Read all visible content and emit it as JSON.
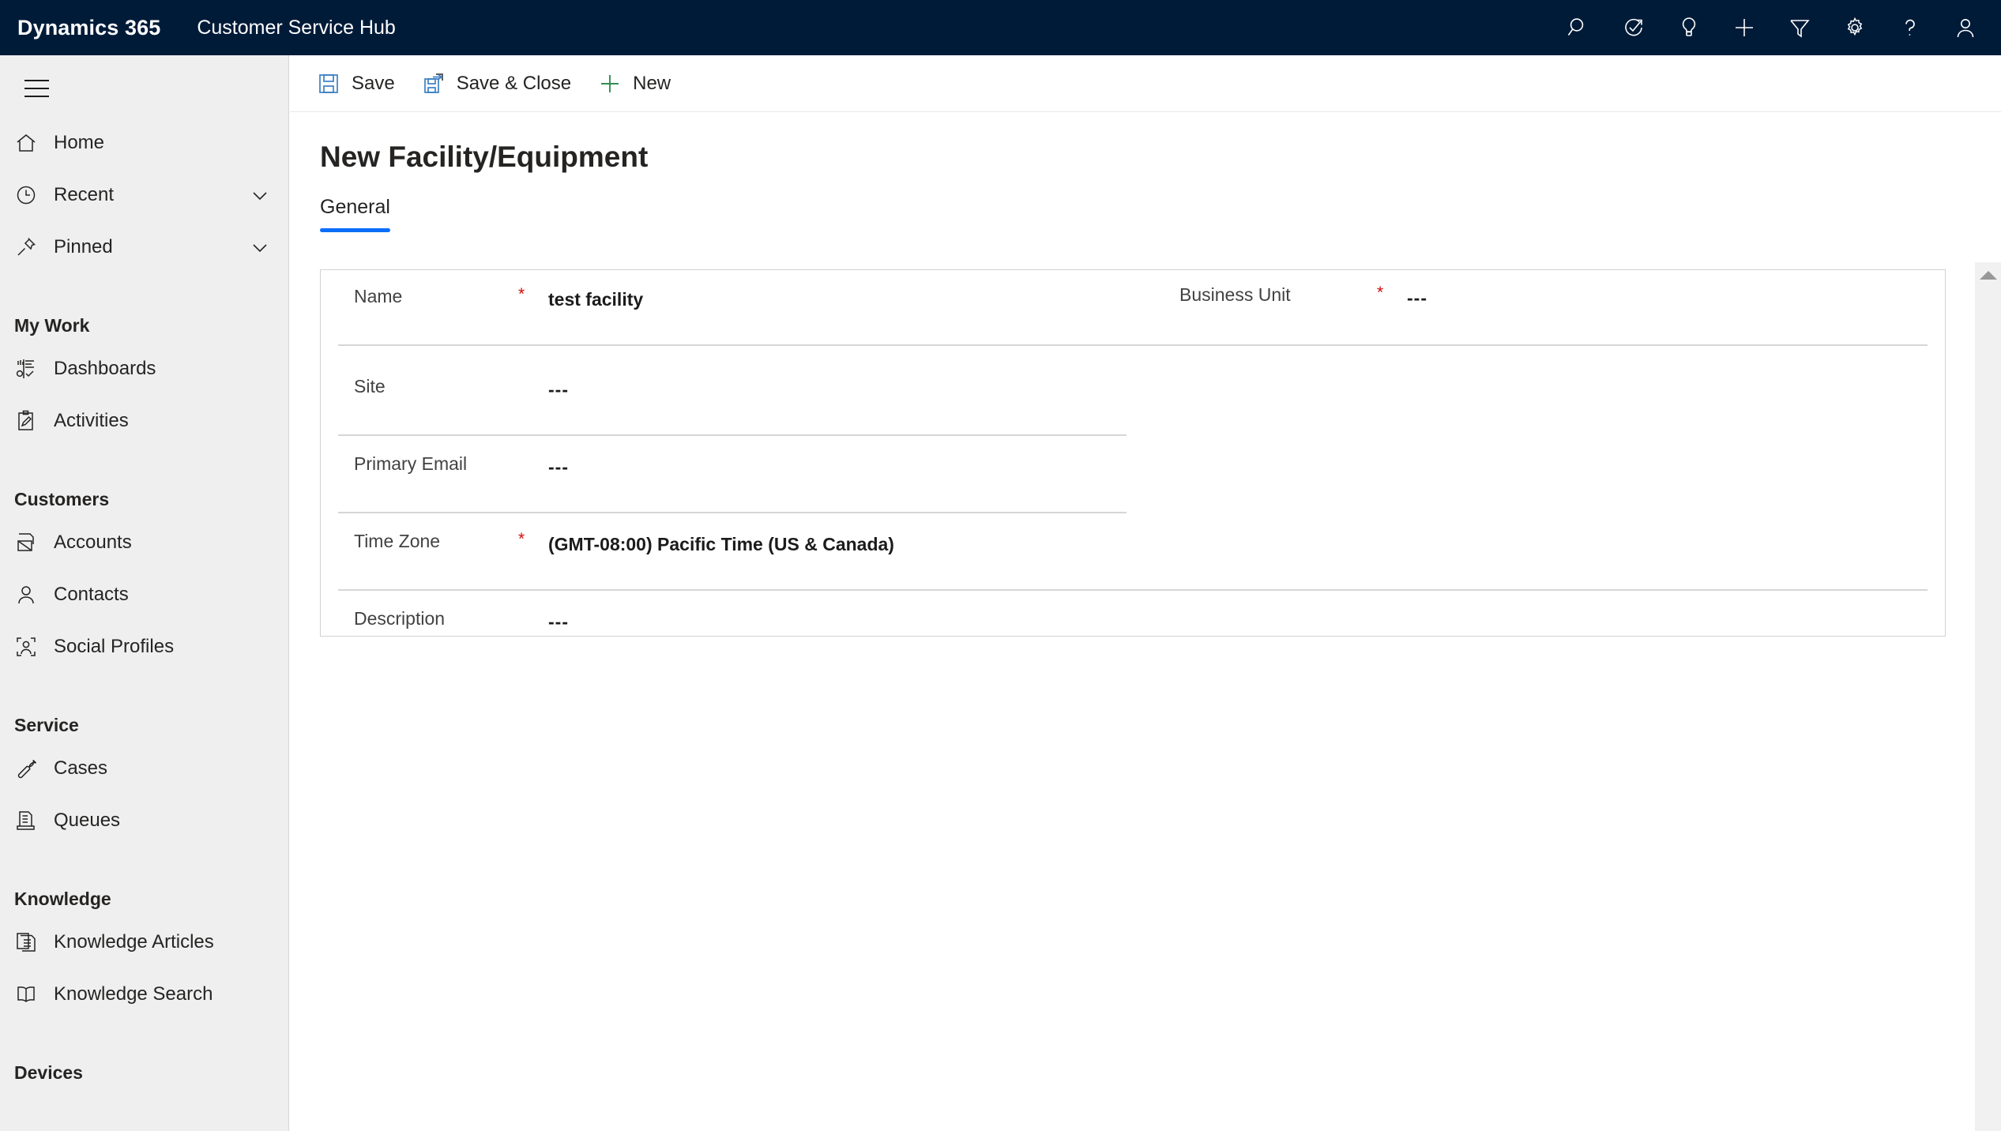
{
  "header": {
    "brand": "Dynamics 365",
    "app_name": "Customer Service Hub",
    "icons": [
      {
        "name": "search-icon",
        "label": "Search"
      },
      {
        "name": "diagnostics-icon",
        "label": "Diagnostics"
      },
      {
        "name": "lightbulb-icon",
        "label": "Assistant"
      },
      {
        "name": "plus-icon",
        "label": "Quick create"
      },
      {
        "name": "filter-icon",
        "label": "Filter"
      },
      {
        "name": "gear-icon",
        "label": "Settings"
      },
      {
        "name": "help-icon",
        "label": "Help"
      },
      {
        "name": "account-icon",
        "label": "Account manager"
      }
    ]
  },
  "commandbar": {
    "buttons": [
      {
        "name": "save-button",
        "label": "Save",
        "icon": "save-icon"
      },
      {
        "name": "save-and-close-button",
        "label": "Save & Close",
        "icon": "save-close-icon"
      },
      {
        "name": "new-button",
        "label": "New",
        "icon": "plus-icon"
      }
    ]
  },
  "sidebar": {
    "hamburger_label": "Site Map",
    "top_items": [
      {
        "name": "sidebar-item-home",
        "label": "Home",
        "icon": "home-icon",
        "expandable": false
      },
      {
        "name": "sidebar-item-recent",
        "label": "Recent",
        "icon": "clock-icon",
        "expandable": true
      },
      {
        "name": "sidebar-item-pinned",
        "label": "Pinned",
        "icon": "pin-icon",
        "expandable": true
      }
    ],
    "groups": [
      {
        "title": "My Work",
        "items": [
          {
            "name": "sidebar-item-dashboards",
            "label": "Dashboards",
            "icon": "dashboard-icon"
          },
          {
            "name": "sidebar-item-activities",
            "label": "Activities",
            "icon": "activities-icon"
          }
        ]
      },
      {
        "title": "Customers",
        "items": [
          {
            "name": "sidebar-item-accounts",
            "label": "Accounts",
            "icon": "accounts-icon"
          },
          {
            "name": "sidebar-item-contacts",
            "label": "Contacts",
            "icon": "contact-icon"
          },
          {
            "name": "sidebar-item-social-profiles",
            "label": "Social Profiles",
            "icon": "social-profile-icon"
          }
        ]
      },
      {
        "title": "Service",
        "items": [
          {
            "name": "sidebar-item-cases",
            "label": "Cases",
            "icon": "wrench-icon"
          },
          {
            "name": "sidebar-item-queues",
            "label": "Queues",
            "icon": "queues-icon"
          }
        ]
      },
      {
        "title": "Knowledge",
        "items": [
          {
            "name": "sidebar-item-knowledge-articles",
            "label": "Knowledge Articles",
            "icon": "article-icon"
          },
          {
            "name": "sidebar-item-knowledge-search",
            "label": "Knowledge Search",
            "icon": "book-icon"
          }
        ]
      },
      {
        "title": "Devices",
        "items": []
      }
    ]
  },
  "main": {
    "page_title": "New Facility/Equipment",
    "tabs": [
      {
        "name": "tab-general",
        "label": "General",
        "selected": true
      }
    ],
    "accent_color": "#0b6efd",
    "required_color": "#d40a0a",
    "form": {
      "left_fields": [
        {
          "name": "field-name",
          "label": "Name",
          "required": true,
          "value": "test facility",
          "divider": "full"
        },
        {
          "name": "field-site",
          "label": "Site",
          "required": false,
          "value": "---",
          "divider": "half"
        },
        {
          "name": "field-primary-email",
          "label": "Primary Email",
          "required": false,
          "value": "---",
          "divider": "half"
        },
        {
          "name": "field-time-zone",
          "label": "Time Zone",
          "required": true,
          "value": "(GMT-08:00) Pacific Time (US & Canada)",
          "divider": "full"
        },
        {
          "name": "field-description",
          "label": "Description",
          "required": false,
          "value": "---",
          "divider": "full"
        }
      ],
      "right_fields": [
        {
          "name": "field-business-unit",
          "label": "Business Unit",
          "required": true,
          "value": "---"
        }
      ]
    }
  },
  "scrollbar": {
    "up_arrow_label": "Scroll up"
  }
}
